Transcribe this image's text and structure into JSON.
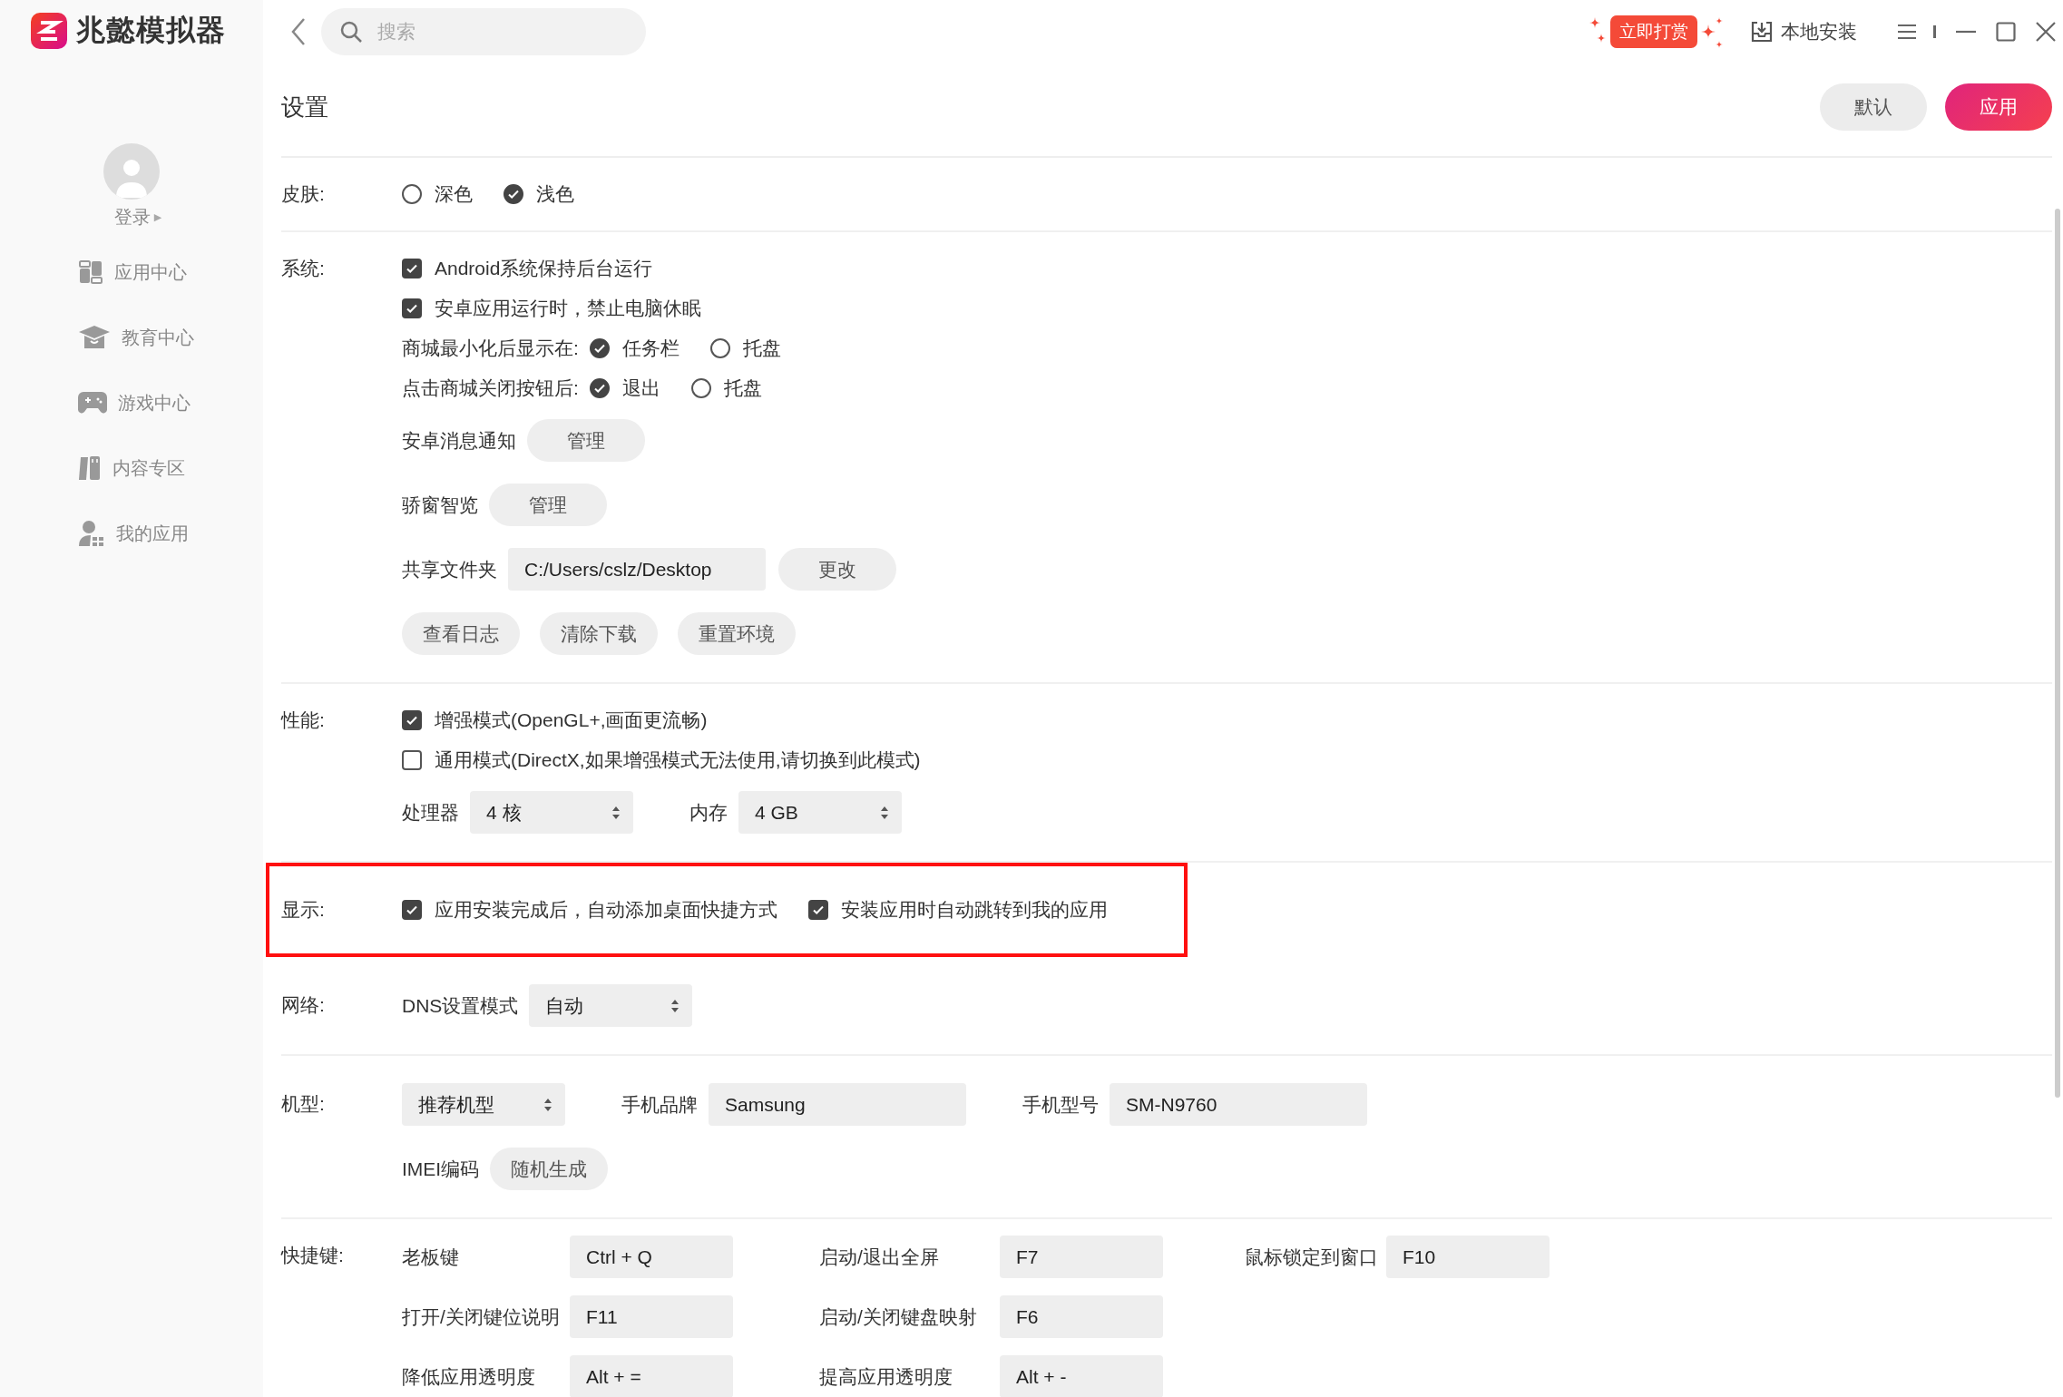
{
  "app": {
    "name": "兆懿模拟器"
  },
  "sidebar": {
    "login": "登录",
    "login_arrow": "▶",
    "items": [
      {
        "label": "应用中心"
      },
      {
        "label": "教育中心"
      },
      {
        "label": "游戏中心"
      },
      {
        "label": "内容专区"
      },
      {
        "label": "我的应用"
      }
    ]
  },
  "topbar": {
    "search_placeholder": "搜索",
    "reward": "立即打赏",
    "local_install": "本地安装"
  },
  "settings": {
    "title": "设置",
    "buttons": [
      {
        "label": "默认",
        "kind": "secondary"
      },
      {
        "label": "应用",
        "kind": "primary"
      }
    ],
    "sections": [
      {
        "label": "皮肤:",
        "highlighted": false,
        "rows": [
          [
            {
              "kind": "radio",
              "label": "深色",
              "selected": false
            },
            {
              "kind": "radio",
              "label": "浅色",
              "selected": true
            }
          ]
        ]
      },
      {
        "label": "系统:",
        "highlighted": false,
        "rows": [
          [
            {
              "kind": "checkbox",
              "label": "Android系统保持后台运行",
              "checked": true
            }
          ],
          [
            {
              "kind": "checkbox",
              "label": "安卓应用运行时，禁止电脑休眠",
              "checked": true
            }
          ],
          [
            {
              "kind": "text",
              "text": "商城最小化后显示在:"
            },
            {
              "kind": "radio",
              "label": "任务栏",
              "selected": true
            },
            {
              "kind": "radio",
              "label": "托盘",
              "selected": false
            }
          ],
          [
            {
              "kind": "text",
              "text": "点击商城关闭按钮后:"
            },
            {
              "kind": "radio",
              "label": "退出",
              "selected": true
            },
            {
              "kind": "radio",
              "label": "托盘",
              "selected": false
            }
          ],
          [
            {
              "kind": "text",
              "text": "安卓消息通知"
            },
            {
              "kind": "button",
              "label": "管理"
            }
          ],
          [
            {
              "kind": "text",
              "text": "骄窗智览"
            },
            {
              "kind": "button",
              "label": "管理"
            }
          ],
          [
            {
              "kind": "text",
              "text": "共享文件夹"
            },
            {
              "kind": "field",
              "value": "C:/Users/cslz/Desktop"
            },
            {
              "kind": "button",
              "label": "更改"
            }
          ],
          [
            {
              "kind": "button",
              "label": "查看日志"
            },
            {
              "kind": "button",
              "label": "清除下载"
            },
            {
              "kind": "button",
              "label": "重置环境"
            }
          ]
        ]
      },
      {
        "label": "性能:",
        "highlighted": false,
        "rows": [
          [
            {
              "kind": "checkbox",
              "label": "增强模式(OpenGL+,画面更流畅)",
              "checked": true
            }
          ],
          [
            {
              "kind": "checkbox",
              "label": "通用模式(DirectX,如果增强模式无法使用,请切换到此模式)",
              "checked": false
            }
          ],
          [
            {
              "kind": "text",
              "text": "处理器"
            },
            {
              "kind": "select",
              "value": "4 核"
            },
            {
              "kind": "text",
              "text": "内存"
            },
            {
              "kind": "select",
              "value": "4 GB"
            }
          ]
        ]
      },
      {
        "label": "显示:",
        "highlighted": true,
        "rows": [
          [
            {
              "kind": "checkbox",
              "label": "应用安装完成后，自动添加桌面快捷方式",
              "checked": true
            },
            {
              "kind": "checkbox",
              "label": "安装应用时自动跳转到我的应用",
              "checked": true
            }
          ]
        ]
      },
      {
        "label": "网络:",
        "highlighted": false,
        "rows": [
          [
            {
              "kind": "text",
              "text": "DNS设置模式"
            },
            {
              "kind": "select",
              "value": "自动"
            }
          ]
        ]
      },
      {
        "label": "机型:",
        "highlighted": false,
        "rows": [
          [
            {
              "kind": "select",
              "value": "推荐机型"
            },
            {
              "kind": "text",
              "text": "手机品牌"
            },
            {
              "kind": "field",
              "value": "Samsung"
            },
            {
              "kind": "text",
              "text": "手机型号"
            },
            {
              "kind": "field",
              "value": "SM-N9760"
            }
          ],
          [
            {
              "kind": "text",
              "text": "IMEI编码"
            },
            {
              "kind": "button",
              "label": "随机生成"
            }
          ]
        ]
      }
    ],
    "shortcuts": {
      "label": "快捷键:",
      "items": [
        {
          "label": "老板键",
          "value": "Ctrl + Q"
        },
        {
          "label": "启动/退出全屏",
          "value": "F7"
        },
        {
          "label": "鼠标锁定到窗口",
          "value": "F10"
        },
        {
          "label": "打开/关闭键位说明",
          "value": "F11"
        },
        {
          "label": "启动/关闭键盘映射",
          "value": "F6"
        },
        {
          "label": "降低应用透明度",
          "value": "Alt + ="
        },
        {
          "label": "提高应用透明度",
          "value": "Alt + -"
        }
      ]
    }
  }
}
